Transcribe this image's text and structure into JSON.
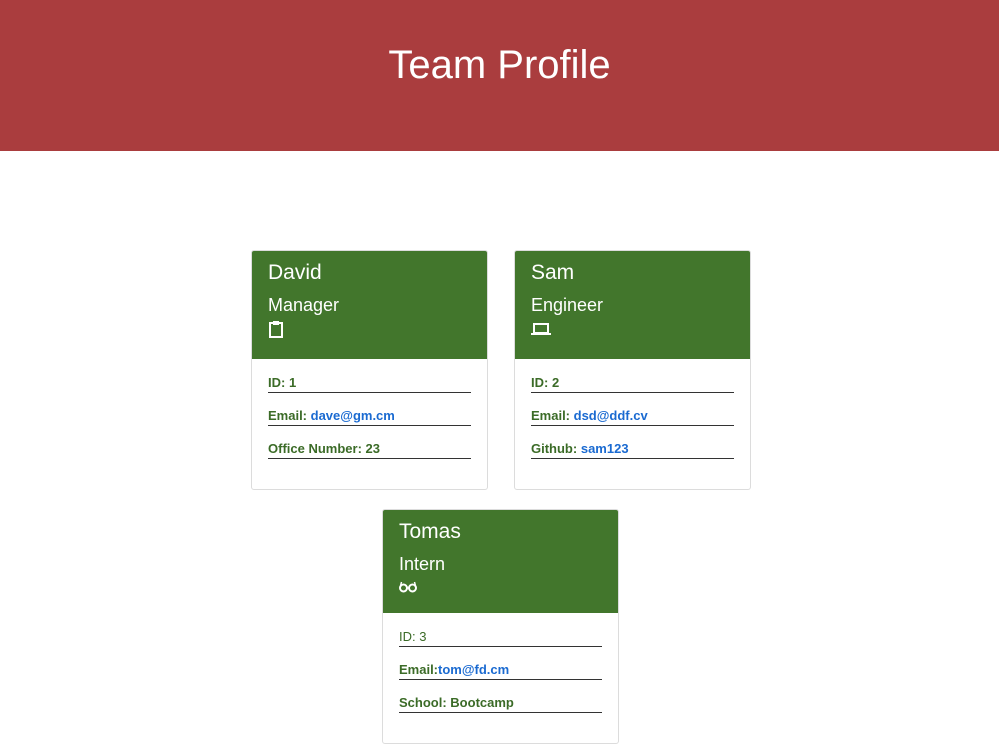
{
  "header": {
    "title": "Team Profile"
  },
  "colors": {
    "header_bg": "#aa3d3e",
    "card_head_bg": "#42762c",
    "link": "#1a6ad1",
    "field_text": "#3b6b27"
  },
  "cards": [
    {
      "name": "David",
      "role": "Manager",
      "icon": "clipboard-icon",
      "id_label": "ID:",
      "id_value": "1",
      "email_label": "Email:",
      "email_value": "dave@gm.cm",
      "extra_label": "Office Number:",
      "extra_value": "23"
    },
    {
      "name": "Sam",
      "role": "Engineer",
      "icon": "laptop-icon",
      "id_label": "ID:",
      "id_value": "2",
      "email_label": "Email:",
      "email_value": "dsd@ddf.cv",
      "extra_label": "Github:",
      "extra_value": "sam123"
    },
    {
      "name": "Tomas",
      "role": "Intern",
      "icon": "glasses-icon",
      "id_label": "ID:",
      "id_value": "3",
      "email_label": "Email:",
      "email_value": "tom@fd.cm",
      "extra_label": "School:",
      "extra_value": "Bootcamp"
    }
  ]
}
